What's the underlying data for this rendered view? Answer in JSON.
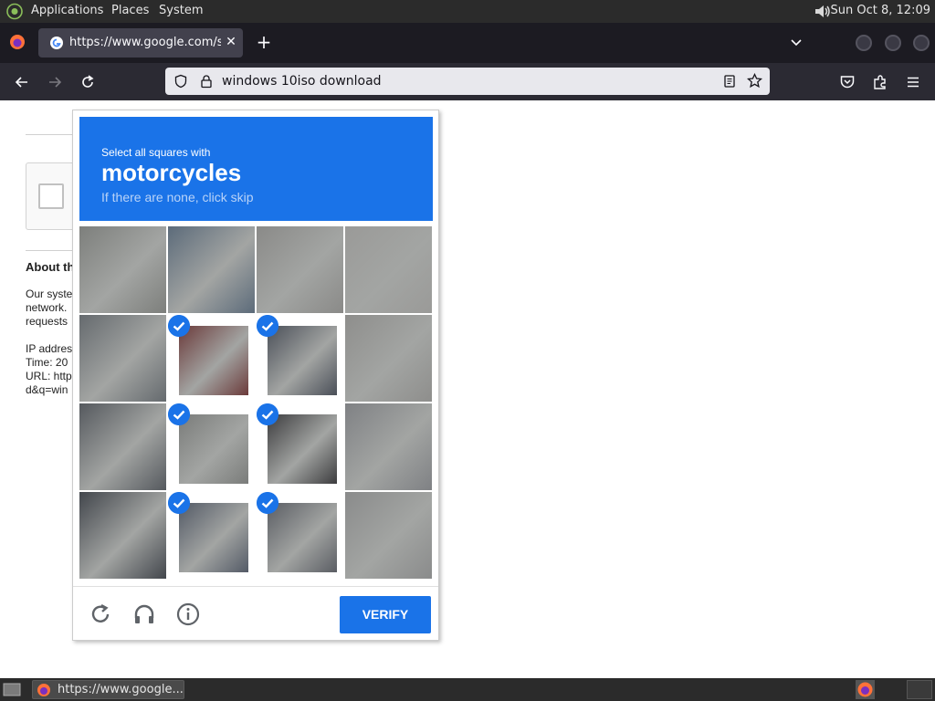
{
  "top_panel": {
    "menus": [
      "Applications",
      "Places",
      "System"
    ],
    "clock": "Sun Oct  8, 12:09"
  },
  "browser": {
    "tab_title": "https://www.google.com/se",
    "tab_close": "✕",
    "new_tab": "+",
    "url": "windows 10iso download"
  },
  "page": {
    "about_heading": "About th",
    "lines": [
      "Our syste",
      "network.",
      "requests",
      "",
      "IP addres",
      "Time: 20",
      "URL: http",
      "d&q=win"
    ]
  },
  "captcha": {
    "line1": "Select all squares with",
    "target": "motorcycles",
    "line3": "If there are none, click skip",
    "accent_color": "#1a73e8",
    "selected_tiles": [
      5,
      6,
      9,
      10,
      13,
      14
    ],
    "verify_label": "VERIFY",
    "footer_icons": [
      "reload-icon",
      "audio-challenge-icon",
      "info-icon"
    ]
  },
  "taskbar": {
    "item_label": "https://www.google..."
  }
}
